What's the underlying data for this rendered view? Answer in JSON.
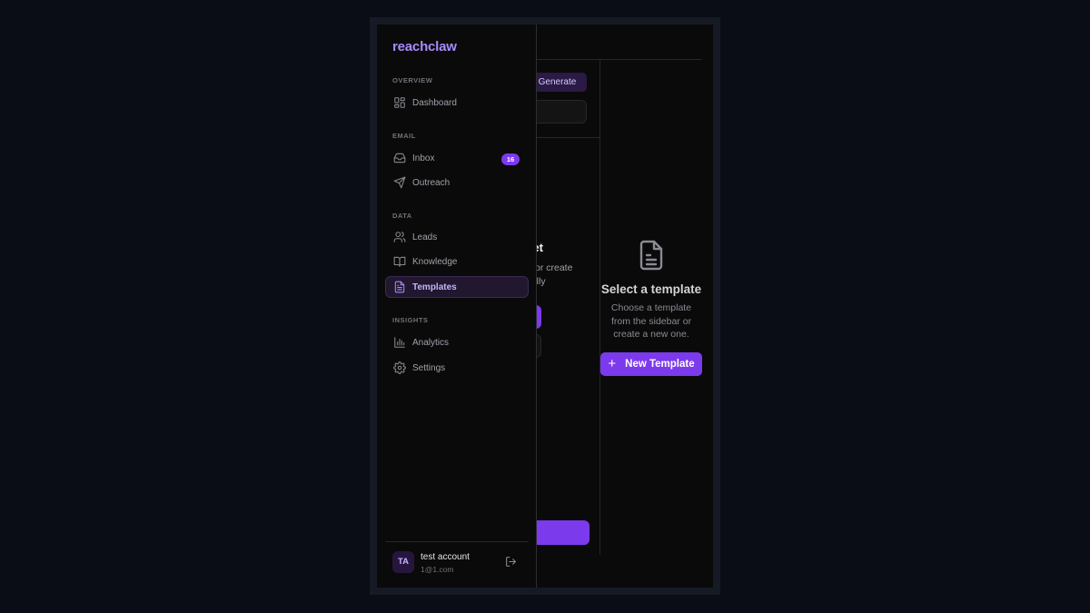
{
  "app": {
    "brand": "reachclaw"
  },
  "toolbar": {
    "generate_label": "Generate"
  },
  "list_panel": {
    "empty_title": "No templates yet",
    "empty_desc_line1": "or create",
    "empty_desc_line2": "ually"
  },
  "detail_panel": {
    "icon": "file-text-icon",
    "title": "Select a template",
    "description": "Choose a template from the sidebar or create a new one.",
    "new_button_label": "New Template",
    "new_button_icon": "plus-icon"
  },
  "sidebar": {
    "sections": {
      "overview": "OVERVIEW",
      "email": "EMAIL",
      "data": "DATA",
      "insights": "INSIGHTS"
    },
    "items": {
      "dashboard": {
        "label": "Dashboard",
        "icon": "dashboard-icon"
      },
      "inbox": {
        "label": "Inbox",
        "icon": "inbox-icon",
        "badge": "16"
      },
      "outreach": {
        "label": "Outreach",
        "icon": "send-icon"
      },
      "leads": {
        "label": "Leads",
        "icon": "users-icon"
      },
      "knowledge": {
        "label": "Knowledge",
        "icon": "book-icon"
      },
      "templates": {
        "label": "Templates",
        "icon": "file-text-icon",
        "active": true
      },
      "analytics": {
        "label": "Analytics",
        "icon": "bar-chart-icon"
      },
      "settings": {
        "label": "Settings",
        "icon": "gear-icon"
      }
    }
  },
  "user": {
    "initials": "TA",
    "name": "test account",
    "email": "1@1.com"
  },
  "colors": {
    "accent": "#7c3aed",
    "brand": "#a78bfa",
    "background": "#0a0a0a",
    "page_background": "#0a0d15"
  }
}
